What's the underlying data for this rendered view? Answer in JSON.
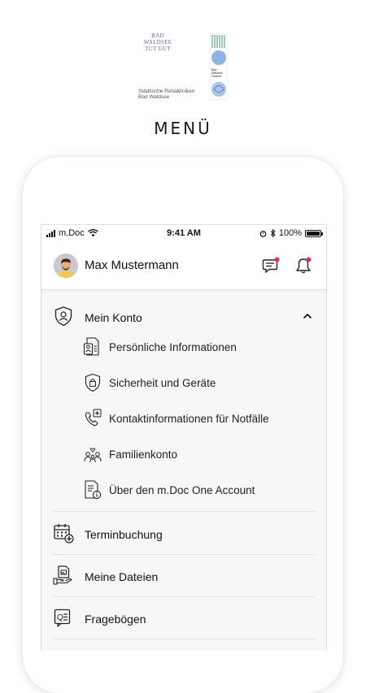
{
  "logo": {
    "top_text_line1": "BAD WALDSEE",
    "top_text_line2": "TUT GUT",
    "panel_text": "Bad Waldsee Therme",
    "bottom_text_line1": "Städtische Rehakliniken",
    "bottom_text_line2": "Bad Waldsee"
  },
  "page_title": "MENÜ",
  "statusbar": {
    "carrier": "m.Doc",
    "time": "9:41 AM",
    "battery": "100%"
  },
  "header": {
    "user_name": "Max Mustermann"
  },
  "menu": {
    "account": {
      "label": "Mein Konto",
      "items": [
        {
          "label": "Persönliche Informationen"
        },
        {
          "label": "Sicherheit und Geräte"
        },
        {
          "label": "Kontaktinformationen für Notfälle"
        },
        {
          "label": "Familienkonto"
        },
        {
          "label": "Über den m.Doc One Account"
        }
      ]
    },
    "appointments": {
      "label": "Terminbuchung"
    },
    "files": {
      "label": "Meine Dateien"
    },
    "questionnaires": {
      "label": "Fragebögen"
    }
  },
  "colors": {
    "notification_dot": "#e8334a",
    "logo_blue": "#5e6bb0",
    "logo_green": "#2f8f5b",
    "logo_lightblue": "#8fb3e0"
  }
}
